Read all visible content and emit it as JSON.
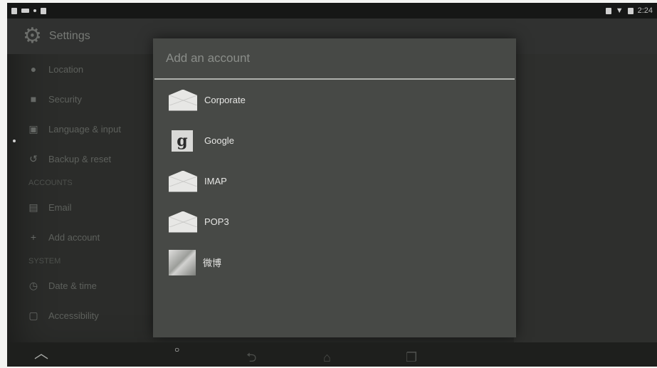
{
  "status_bar": {
    "clock": "2:24",
    "left_icons": [
      "notification-icon",
      "notification-icon",
      "notification-icon",
      "notification-icon"
    ],
    "right_icons": [
      "alarm-icon",
      "wifi-icon",
      "battery-icon"
    ]
  },
  "settings": {
    "title": "Settings",
    "items": [
      {
        "icon": "location-icon",
        "label": "Location"
      },
      {
        "icon": "lock-icon",
        "label": "Security"
      },
      {
        "icon": "language-icon",
        "label": "Language & input"
      },
      {
        "icon": "backup-icon",
        "label": "Backup & reset"
      }
    ],
    "category_accounts": "ACCOUNTS",
    "account_items": [
      {
        "icon": "account-icon",
        "label": "Email"
      },
      {
        "icon": "add-icon",
        "label": "Add account"
      }
    ],
    "category_system": "SYSTEM",
    "system_items": [
      {
        "icon": "clock-icon",
        "label": "Date & time"
      },
      {
        "icon": "accessibility-icon",
        "label": "Accessibility"
      }
    ]
  },
  "dialog": {
    "title": "Add an account",
    "accounts": [
      {
        "label": "Corporate",
        "icon": "envelope-icon"
      },
      {
        "label": "Google",
        "icon": "google-icon",
        "icon_glyph": "g"
      },
      {
        "label": "IMAP",
        "icon": "envelope-icon"
      },
      {
        "label": "POP3",
        "icon": "envelope-icon"
      },
      {
        "label": "微博",
        "icon": "app-icon"
      }
    ]
  },
  "nav_bar": {
    "icons": [
      "up-caret-icon",
      "menu-dot-icon",
      "back-icon",
      "home-icon",
      "recent-apps-icon"
    ]
  }
}
